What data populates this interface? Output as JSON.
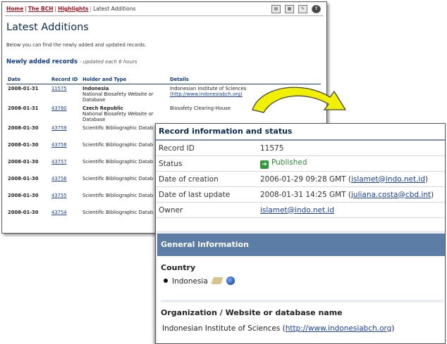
{
  "breadcrumb": {
    "items": [
      "Home",
      "The BCH",
      "Highlights"
    ],
    "current": "Latest Additions"
  },
  "toolbar": {
    "icons": [
      "print-icon",
      "export-icon",
      "tools-icon",
      "help-icon"
    ]
  },
  "page": {
    "title": "Latest Additions",
    "intro": "Below you can find the newly added and updated records.",
    "section_title": "Newly added records",
    "section_note": "- updated each 6 hours"
  },
  "table": {
    "headers": [
      "Date",
      "Record ID",
      "Holder and Type",
      "Details"
    ],
    "rows": [
      {
        "date": "2008-01-31",
        "id": "11575",
        "holder": "Indonesia",
        "type": "National Biosafety Website or Database",
        "details": "Indonesian Institute of Sciences",
        "details_link": "(http://www.indonesiabch.org)"
      },
      {
        "date": "2008-01-31",
        "id": "43760",
        "holder": "Czech Republic",
        "type": "National Biosafety Website or Database",
        "details": "Biosafety Clearing-House",
        "details_link": ""
      },
      {
        "date": "2008-01-30",
        "id": "43759",
        "holder": "",
        "type": "Scientific Bibliographic Datab",
        "details": "",
        "details_link": ""
      },
      {
        "date": "2008-01-30",
        "id": "43758",
        "holder": "",
        "type": "Scientific Bibliographic Datab",
        "details": "",
        "details_link": ""
      },
      {
        "date": "2008-01-30",
        "id": "43757",
        "holder": "",
        "type": "Scientific Bibliographic Datab",
        "details": "",
        "details_link": ""
      },
      {
        "date": "2008-01-30",
        "id": "43756",
        "holder": "",
        "type": "Scientific Bibliographic Datab",
        "details": "",
        "details_link": ""
      },
      {
        "date": "2008-01-30",
        "id": "43755",
        "holder": "",
        "type": "Scientific Bibliographic Datab",
        "details": "",
        "details_link": ""
      },
      {
        "date": "2008-01-30",
        "id": "43754",
        "holder": "",
        "type": "Scientific Bibliographic Datab",
        "details": "",
        "details_link": ""
      }
    ]
  },
  "record": {
    "title": "Record information and status",
    "rows": [
      {
        "label": "Record ID",
        "value": "11575",
        "link": ""
      },
      {
        "label": "Status",
        "value": "Published",
        "link": ""
      },
      {
        "label": "Date of creation",
        "value": "2006-01-29 09:28 GMT (",
        "link": "islamet@indo.net.id",
        "after": ")"
      },
      {
        "label": "Date of last update",
        "value": "2008-01-31 14:25 GMT (",
        "link": "juliana.costa@cbd.int",
        "after": ")"
      },
      {
        "label": "Owner",
        "value": "",
        "link": "islamet@indo.net.id",
        "after": ""
      }
    ]
  },
  "general": {
    "header": "General information",
    "country_label": "Country",
    "country_value": "Indonesia",
    "org_label": "Organization / Website or database name",
    "org_value": "Indonesian Institute of Sciences (",
    "org_link": "http://www.indonesiabch.org",
    "org_after": ")"
  },
  "colors": {
    "accent": "#5c7ea6",
    "breadcrumb": "#b1121b",
    "published": "#2f9a3a",
    "arrow": "#f0f000"
  }
}
